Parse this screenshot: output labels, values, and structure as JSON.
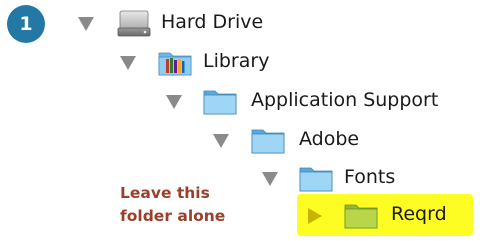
{
  "step": {
    "number": "1",
    "color": "#2378a6"
  },
  "tree": {
    "items": [
      {
        "label": "Hard Drive",
        "icon": "hard-drive-icon",
        "expanded": true
      },
      {
        "label": "Library",
        "icon": "library-folder-icon",
        "expanded": true
      },
      {
        "label": "Application Support",
        "icon": "folder-icon",
        "expanded": true
      },
      {
        "label": "Adobe",
        "icon": "folder-icon",
        "expanded": true
      },
      {
        "label": "Fonts",
        "icon": "folder-icon",
        "expanded": true
      },
      {
        "label": "Reqrd",
        "icon": "folder-icon",
        "expanded": false,
        "highlighted": true
      }
    ]
  },
  "annotation": {
    "line1": "Leave this",
    "line2": "folder alone",
    "color": "#9a3f2a"
  },
  "colors": {
    "highlight": "#fdfc23",
    "disclosure": "#8a8a8a",
    "folder": "#7cc3ec"
  }
}
